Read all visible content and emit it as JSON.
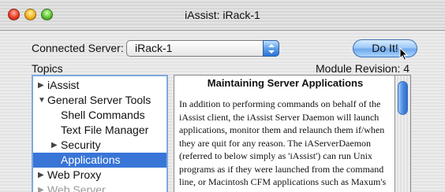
{
  "window": {
    "title": "iAssist: iRack-1"
  },
  "server": {
    "label": "Connected Server:",
    "selected": "iRack-1"
  },
  "buttons": {
    "do_it": "Do It!"
  },
  "topics": {
    "label": "Topics",
    "items": [
      {
        "label": "iAssist",
        "expand": "▶"
      },
      {
        "label": "General Server Tools",
        "expand": "▼"
      },
      {
        "label": "Shell Commands",
        "expand": ""
      },
      {
        "label": "Text File Manager",
        "expand": ""
      },
      {
        "label": "Security",
        "expand": "▶"
      },
      {
        "label": "Applications",
        "expand": ""
      },
      {
        "label": "Web Proxy",
        "expand": "▶"
      },
      {
        "label": "Web Server",
        "expand": "▶"
      }
    ]
  },
  "module": {
    "label": "Module Revision: 4"
  },
  "document": {
    "title": "Maintaining Server Applications",
    "body": "In addition to performing commands on behalf of the iAssist client, the iAssist Server Daemon will launch applications, monitor them and relaunch them if/when they are quit for any reason.  The iAServerDaemon (referred to below simply as 'iAssist') can run Unix programs as if they were launched from the command line, or Macintosh CFM applications such as Maxum's own NetCloak, Rumpus, and PageSentry products."
  },
  "colors": {
    "selection": "#3875d7",
    "accent_blue": "#5fa0e8"
  }
}
